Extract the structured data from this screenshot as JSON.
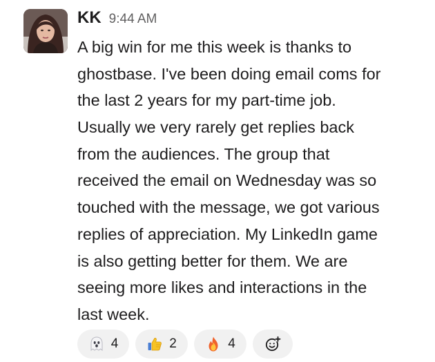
{
  "message": {
    "sender": "KK",
    "timestamp": "9:44 AM",
    "lines": [
      "A big win for me this week is thanks to",
      "ghostbase. I've been doing email coms for",
      "the last 2 years for my part-time job.",
      "Usually we very rarely get replies back",
      "from the audiences. The group that",
      "received the email on Wednesday was so",
      "touched with the message, we got various",
      "replies of appreciation. My LinkedIn game",
      "is also getting better for them. We are",
      "seeing more likes and interactions in the",
      "last week."
    ]
  },
  "reactions": [
    {
      "icon": "ghost-icon",
      "count": "4"
    },
    {
      "icon": "thumbs-up-icon",
      "count": "2"
    },
    {
      "icon": "fire-icon",
      "count": "4"
    }
  ],
  "add_reaction": {
    "icon": "add-reaction-icon"
  },
  "colors": {
    "text": "#1d1c1d",
    "muted": "#616061",
    "pill_background": "#f1f1f1"
  }
}
